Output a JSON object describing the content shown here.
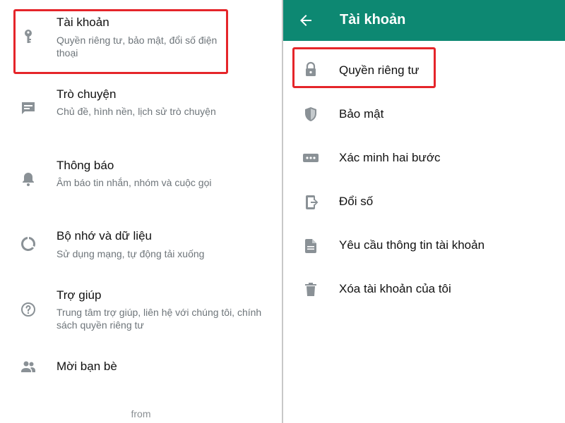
{
  "left": {
    "items": [
      {
        "title": "Tài khoản",
        "subtitle": "Quyền riêng tư, bảo mật, đổi số điện thoại",
        "icon": "key-icon"
      },
      {
        "title": "Trò chuyện",
        "subtitle": "Chủ đề, hình nền, lịch sử trò chuyện",
        "icon": "chat-icon"
      },
      {
        "title": "Thông báo",
        "subtitle": "Âm báo tin nhắn, nhóm và cuộc gọi",
        "icon": "bell-icon"
      },
      {
        "title": "Bộ nhớ và dữ liệu",
        "subtitle": "Sử dụng mạng, tự động tải xuống",
        "icon": "data-usage-icon"
      },
      {
        "title": "Trợ giúp",
        "subtitle": "Trung tâm trợ giúp, liên hệ với chúng tôi, chính sách quyền riêng tư",
        "icon": "help-icon"
      },
      {
        "title": "Mời bạn bè",
        "subtitle": "",
        "icon": "people-icon"
      }
    ],
    "footer": "from"
  },
  "right": {
    "appbar_title": "Tài khoản",
    "items": [
      {
        "title": "Quyền riêng tư",
        "icon": "lock-icon"
      },
      {
        "title": "Bảo mật",
        "icon": "shield-icon"
      },
      {
        "title": "Xác minh hai bước",
        "icon": "dots-icon"
      },
      {
        "title": "Đổi số",
        "icon": "phone-transfer-icon"
      },
      {
        "title": "Yêu cầu thông tin tài khoản",
        "icon": "document-icon"
      },
      {
        "title": "Xóa tài khoản của tôi",
        "icon": "trash-icon"
      }
    ]
  },
  "colors": {
    "appbar": "#0d8872",
    "highlight": "#e5252a",
    "icon": "#8a9196",
    "subtitle": "#6e757a"
  }
}
